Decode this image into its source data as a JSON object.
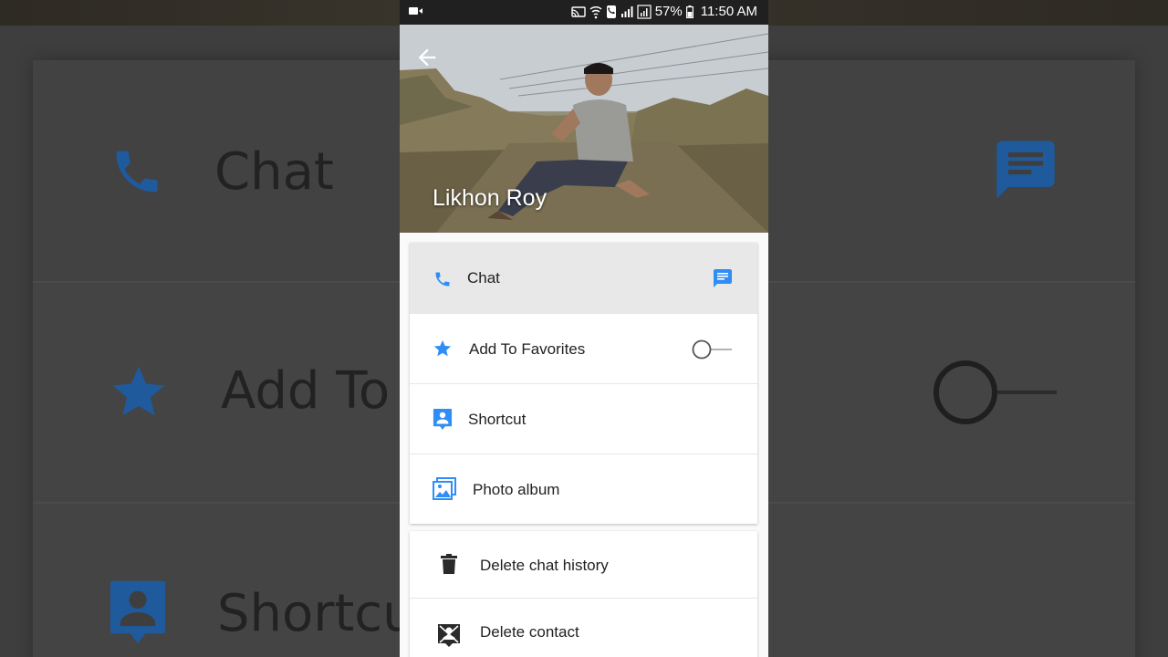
{
  "status_bar": {
    "battery": "57%",
    "time": "11:50 AM"
  },
  "contact": {
    "name": "Likhon Roy"
  },
  "primary_actions": [
    {
      "label": "Chat"
    },
    {
      "label": "Add To Favorites",
      "favorite_on": false
    },
    {
      "label": "Shortcut"
    },
    {
      "label": "Photo album"
    }
  ],
  "secondary_actions": [
    {
      "label": "Delete chat history"
    },
    {
      "label": "Delete contact"
    }
  ],
  "background_zoom": {
    "chat_label": "Chat",
    "add_label": "Add To",
    "shortcut_label": "Shortcu"
  },
  "colors": {
    "accent_blue": "#2f8ef5",
    "chat_row_bg": "#e8e8e8",
    "statusbar_bg": "#202020"
  }
}
